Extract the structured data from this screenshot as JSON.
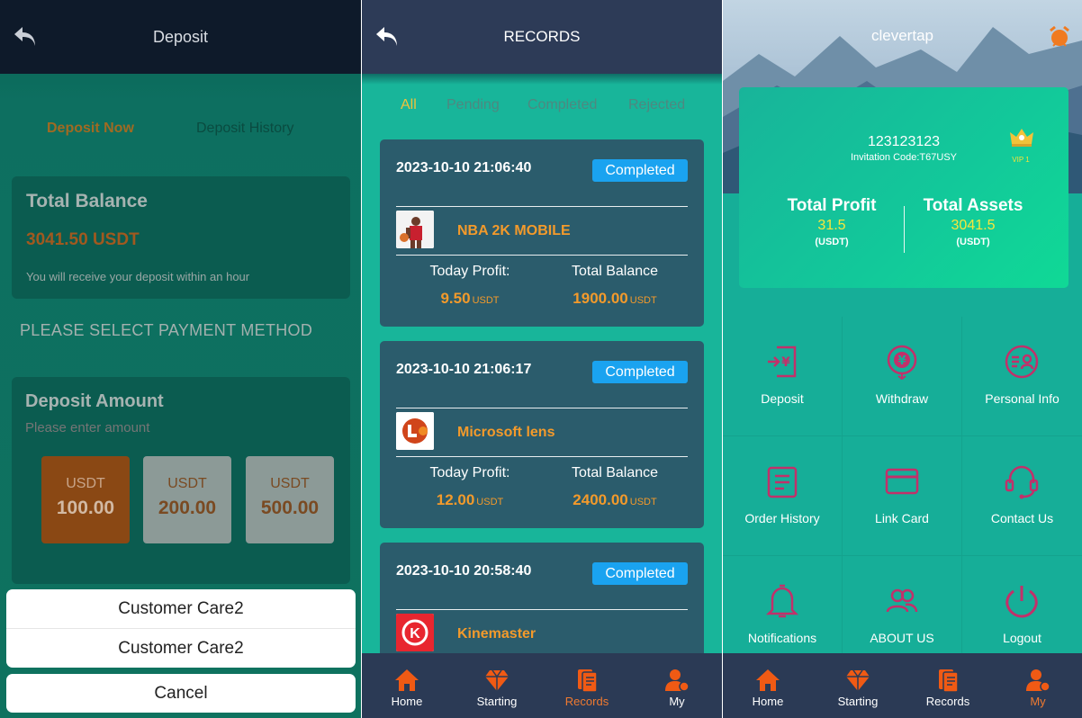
{
  "deposit_panel": {
    "title": "Deposit",
    "tabs": [
      "Deposit Now",
      "Deposit History"
    ],
    "total_balance_label": "Total Balance",
    "total_balance_value": "3041.50 USDT",
    "balance_note": "You will receive your deposit within an hour",
    "payment_method_title": "PLEASE SELECT PAYMENT METHOD",
    "deposit_amount_label": "Deposit Amount",
    "amount_placeholder": "Please enter amount",
    "amount_options": [
      {
        "currency": "USDT",
        "value": "100.00",
        "selected": true
      },
      {
        "currency": "USDT",
        "value": "200.00",
        "selected": false
      },
      {
        "currency": "USDT",
        "value": "500.00",
        "selected": false
      }
    ],
    "action_sheet": [
      "Customer Care2",
      "Customer Care2"
    ],
    "cancel_label": "Cancel"
  },
  "records_panel": {
    "title": "RECORDS",
    "tabs": [
      "All",
      "Pending",
      "Completed",
      "Rejected"
    ],
    "active_tab": "All",
    "today_profit_label": "Today Profit:",
    "total_balance_label": "Total Balance",
    "currency": "USDT",
    "records": [
      {
        "date": "2023-10-10 21:06:40",
        "status": "Completed",
        "name": "NBA 2K MOBILE",
        "today_profit": "9.50",
        "total_balance": "1900.00"
      },
      {
        "date": "2023-10-10 21:06:17",
        "status": "Completed",
        "name": "Microsoft lens",
        "today_profit": "12.00",
        "total_balance": "2400.00"
      },
      {
        "date": "2023-10-10 20:58:40",
        "status": "Completed",
        "name": "Kinemaster",
        "today_profit": "",
        "total_balance": ""
      }
    ],
    "nav": [
      {
        "label": "Home",
        "icon": "home-icon"
      },
      {
        "label": "Starting",
        "icon": "diamond-icon"
      },
      {
        "label": "Records",
        "icon": "records-icon",
        "active": true
      },
      {
        "label": "My",
        "icon": "user-icon"
      }
    ]
  },
  "profile_panel": {
    "title": "clevertap",
    "user_id": "123123123",
    "invitation": "Invitation Code:T67USY",
    "vip": "VIP 1",
    "total_profit_label": "Total Profit",
    "total_profit_value": "31.5",
    "total_assets_label": "Total Assets",
    "total_assets_value": "3041.5",
    "unit": "(USDT)",
    "grid": [
      {
        "label": "Deposit",
        "icon": "deposit-icon"
      },
      {
        "label": "Withdraw",
        "icon": "withdraw-icon"
      },
      {
        "label": "Personal Info",
        "icon": "personal-info-icon"
      },
      {
        "label": "Order History",
        "icon": "order-history-icon"
      },
      {
        "label": "Link Card",
        "icon": "card-icon"
      },
      {
        "label": "Contact Us",
        "icon": "headset-icon"
      },
      {
        "label": "Notifications",
        "icon": "bell-icon"
      },
      {
        "label": "ABOUT US",
        "icon": "users-icon"
      },
      {
        "label": "Logout",
        "icon": "power-icon"
      }
    ],
    "nav": [
      {
        "label": "Home",
        "icon": "home-icon"
      },
      {
        "label": "Starting",
        "icon": "diamond-icon"
      },
      {
        "label": "Records",
        "icon": "records-icon"
      },
      {
        "label": "My",
        "icon": "user-icon",
        "active": true
      }
    ]
  },
  "colors": {
    "accent_orange": "#f39a2b",
    "badge_blue": "#1aa3f0",
    "icon_magenta": "#c2306a",
    "nav_orange": "#f05a14"
  }
}
